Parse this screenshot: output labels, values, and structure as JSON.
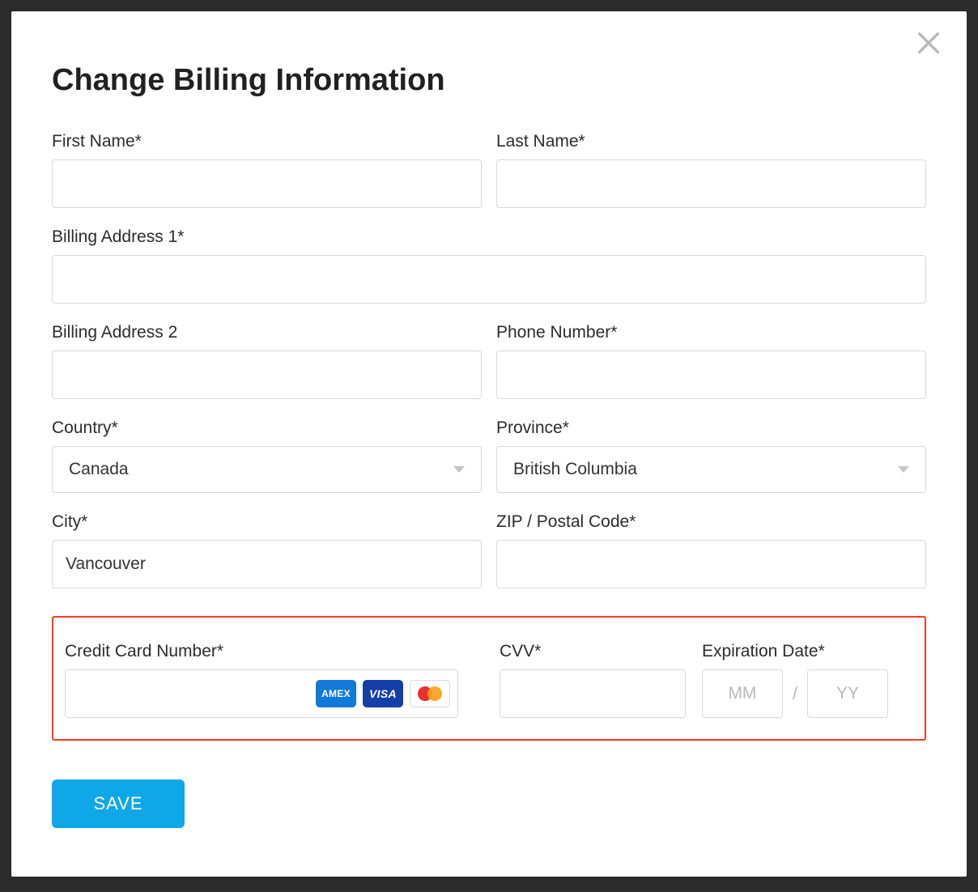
{
  "modal": {
    "title": "Change Billing Information",
    "close_icon": "close"
  },
  "form": {
    "first_name": {
      "label": "First Name*",
      "value": ""
    },
    "last_name": {
      "label": "Last Name*",
      "value": ""
    },
    "address1": {
      "label": "Billing Address 1*",
      "value": ""
    },
    "address2": {
      "label": "Billing Address 2",
      "value": ""
    },
    "phone": {
      "label": "Phone Number*",
      "value": ""
    },
    "country": {
      "label": "Country*",
      "selected": "Canada"
    },
    "province": {
      "label": "Province*",
      "selected": "British Columbia"
    },
    "city": {
      "label": "City*",
      "value": "Vancouver"
    },
    "zip": {
      "label": "ZIP / Postal Code*",
      "value": ""
    },
    "cc_number": {
      "label": "Credit Card Number*",
      "value": ""
    },
    "cvv": {
      "label": "CVV*",
      "value": ""
    },
    "expiration": {
      "label": "Expiration Date*",
      "mm_placeholder": "MM",
      "yy_placeholder": "YY",
      "separator": "/"
    },
    "card_brands": {
      "amex": "AMEX",
      "visa": "VISA",
      "mastercard": "mastercard"
    }
  },
  "actions": {
    "save_label": "SAVE"
  }
}
